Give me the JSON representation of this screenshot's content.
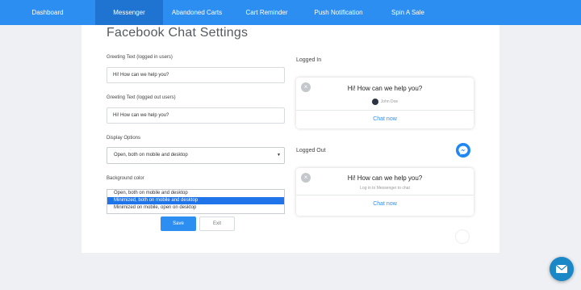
{
  "nav": {
    "items": [
      {
        "label": "Dashboard"
      },
      {
        "label": "Messenger"
      },
      {
        "label": "Abandoned Carts"
      },
      {
        "label": "Cart Reminder"
      },
      {
        "label": "Push Notification"
      },
      {
        "label": "Spin A Sale"
      }
    ],
    "active": "Messenger"
  },
  "page": {
    "title": "Facebook Chat Settings"
  },
  "form": {
    "greeting_in": {
      "label": "Greeting Text (logged in users)",
      "value": "Hi! How can we help you?"
    },
    "greeting_out": {
      "label": "Greeting Text (logged out users)",
      "value": "Hi! How can we help you?"
    },
    "display": {
      "label": "Display Options",
      "value": "Open, both on mobile and desktop"
    },
    "background": {
      "label": "Background color",
      "options": [
        "Open, both on mobile and desktop",
        "Minimized, both on mobile and desktop",
        "Minimized on mobile, open on desktop"
      ],
      "selected": "Minimized, both on mobile and desktop"
    },
    "save_label": "Save",
    "exit_label": "Exit"
  },
  "preview": {
    "logged_in": {
      "heading": "Logged In",
      "greeting": "Hi! How can we help you?",
      "user": "John Doe",
      "link": "Chat now"
    },
    "logged_out": {
      "heading": "Logged Out",
      "greeting": "Hi! How can we help you?",
      "sub": "Log in to Messenger to chat",
      "link": "Chat now"
    }
  },
  "colors": {
    "accent": "#2d8ef2",
    "nav_active": "#1e74d0",
    "selected_option": "#1e74e8",
    "messenger": "#1e86f5",
    "chat_fab": "#1a87c7"
  },
  "icons": {
    "close": "close-icon",
    "messenger": "messenger-icon",
    "chat_fab": "envelope-icon",
    "dropdown": "caret-down-icon"
  }
}
